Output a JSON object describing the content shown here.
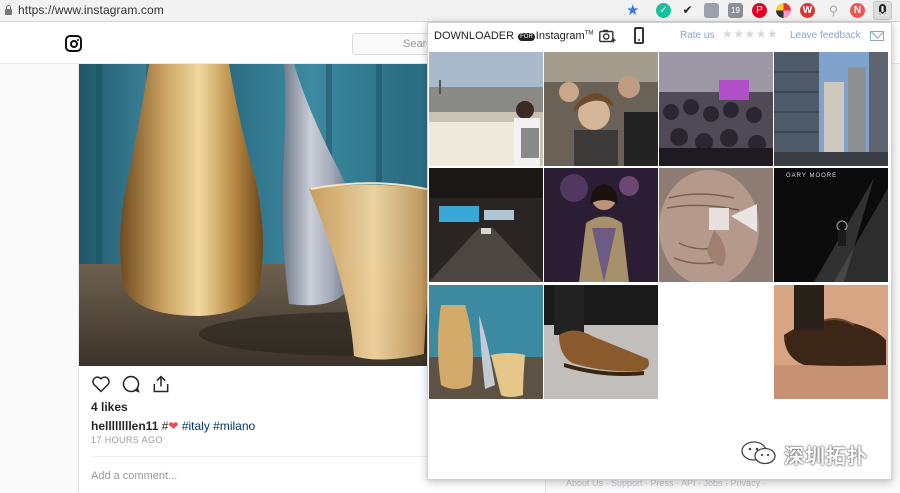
{
  "browser": {
    "url": "https://www.instagram.com",
    "extension_badge_count": "19",
    "extension_letters": [
      "W",
      "N"
    ]
  },
  "instagram": {
    "search_placeholder": "Search",
    "post": {
      "likes": "4 likes",
      "username": "hellllllllen11",
      "caption_tags": "#italy #milano",
      "time": "17 HOURS AGO",
      "comment_placeholder": "Add a comment..."
    },
    "footer_links": "About Us · Support · Press · API · Jobs · Privacy ·"
  },
  "downloader": {
    "brand_prefix": "DOWNLOADER",
    "brand_badge": "FOR",
    "brand_suffix": "Instagram",
    "brand_tm": "TM",
    "rate_label": "Rate us",
    "stars": "★★★★★",
    "feedback_label": "Leave feedback",
    "tiles": [
      {
        "name": "tile-paris-rooftop"
      },
      {
        "name": "tile-crowd-selfie"
      },
      {
        "name": "tile-crowd-event"
      },
      {
        "name": "tile-city-buildings"
      },
      {
        "name": "tile-train-station"
      },
      {
        "name": "tile-woman-portrait"
      },
      {
        "name": "tile-elderly-face"
      },
      {
        "name": "tile-concert-album",
        "text": "GARY MOORE"
      },
      {
        "name": "tile-vases"
      },
      {
        "name": "tile-shoe-street"
      },
      {
        "name": "tile-blank"
      },
      {
        "name": "tile-leather-shoe"
      }
    ]
  },
  "watermark": {
    "text": "深圳拓扑"
  },
  "colors": {
    "accent_blue": "#3f74d8",
    "link_gray_blue": "#8ba5c4",
    "heart_red": "#ed4956",
    "hashtag": "#003569"
  }
}
